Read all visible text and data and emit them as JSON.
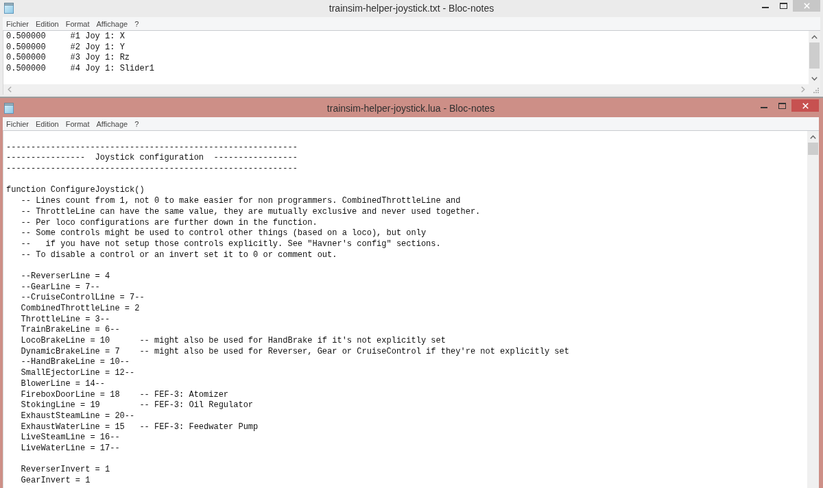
{
  "windows": [
    {
      "title": "trainsim-helper-joystick.txt - Bloc-notes",
      "active": false,
      "cropped": false,
      "menu": [
        "Fichier",
        "Edition",
        "Format",
        "Affichage",
        "?"
      ],
      "lines": [
        {
          "kind": "code",
          "text": "0.500000     #1 Joy 1: X"
        },
        {
          "kind": "code",
          "text": "0.500000     #2 Joy 1: Y"
        },
        {
          "kind": "code",
          "text": "0.500000     #3 Joy 1: Rz"
        },
        {
          "kind": "code",
          "text": "0.500000     #4 Joy 1: Slider1"
        }
      ]
    },
    {
      "title": "trainsim-helper-joystick.lua - Bloc-notes",
      "active": true,
      "cropped": true,
      "menu": [
        "Fichier",
        "Edition",
        "Format",
        "Affichage",
        "?"
      ],
      "lines": [
        {
          "kind": "blank"
        },
        {
          "kind": "code",
          "text": "-----------------------------------------------------------"
        },
        {
          "kind": "code",
          "text": "----------------  Joystick configuration  -----------------"
        },
        {
          "kind": "code",
          "text": "-----------------------------------------------------------"
        },
        {
          "kind": "blank"
        },
        {
          "kind": "code",
          "text": "function ConfigureJoystick()",
          "children": [
            {
              "kind": "code",
              "text": "-- Lines count from 1, not 0 to make easier for non programmers. CombinedThrottleLine and"
            },
            {
              "kind": "code",
              "text": "-- ThrottleLine can have the same value, they are mutually exclusive and never used together."
            },
            {
              "kind": "code",
              "text": "-- Per loco configurations are further down in the function."
            },
            {
              "kind": "code",
              "text": "-- Some controls might be used to control other things (based on a loco), but only"
            },
            {
              "kind": "code",
              "text": "--   if you have not setup those controls explicitly. See \"Havner's config\" sections."
            },
            {
              "kind": "code",
              "text": "-- To disable a control or an invert set it to 0 or comment out."
            },
            {
              "kind": "blank"
            },
            {
              "kind": "code",
              "text": "--ReverserLine = 4"
            },
            {
              "kind": "code",
              "text": "--GearLine = 7--"
            },
            {
              "kind": "code",
              "text": "--CruiseControlLine = 7--"
            },
            {
              "kind": "code",
              "text": "CombinedThrottleLine = 2"
            },
            {
              "kind": "code",
              "text": "ThrottleLine = 3--"
            },
            {
              "kind": "code",
              "text": "TrainBrakeLine = 6--"
            },
            {
              "kind": "code",
              "text": "LocoBrakeLine = 10      -- might also be used for HandBrake if it's not explicitly set"
            },
            {
              "kind": "code",
              "text": "DynamicBrakeLine = 7    -- might also be used for Reverser, Gear or CruiseControl if they're not explicitly set"
            },
            {
              "kind": "code",
              "text": "--HandBrakeLine = 10--"
            },
            {
              "kind": "code",
              "text": "SmallEjectorLine = 12--"
            },
            {
              "kind": "code",
              "text": "BlowerLine = 14--"
            },
            {
              "kind": "code",
              "text": "FireboxDoorLine = 18    -- FEF-3: Atomizer"
            },
            {
              "kind": "code",
              "text": "StokingLine = 19        -- FEF-3: Oil Regulator"
            },
            {
              "kind": "code",
              "text": "ExhaustSteamLine = 20--"
            },
            {
              "kind": "code",
              "text": "ExhaustWaterLine = 15   -- FEF-3: Feedwater Pump"
            },
            {
              "kind": "code",
              "text": "LiveSteamLine = 16--"
            },
            {
              "kind": "code",
              "text": "LiveWaterLine = 17--"
            },
            {
              "kind": "blank"
            },
            {
              "kind": "code",
              "text": "ReverserInvert = 1"
            },
            {
              "kind": "code",
              "text": "GearInvert = 1"
            }
          ]
        }
      ]
    }
  ]
}
